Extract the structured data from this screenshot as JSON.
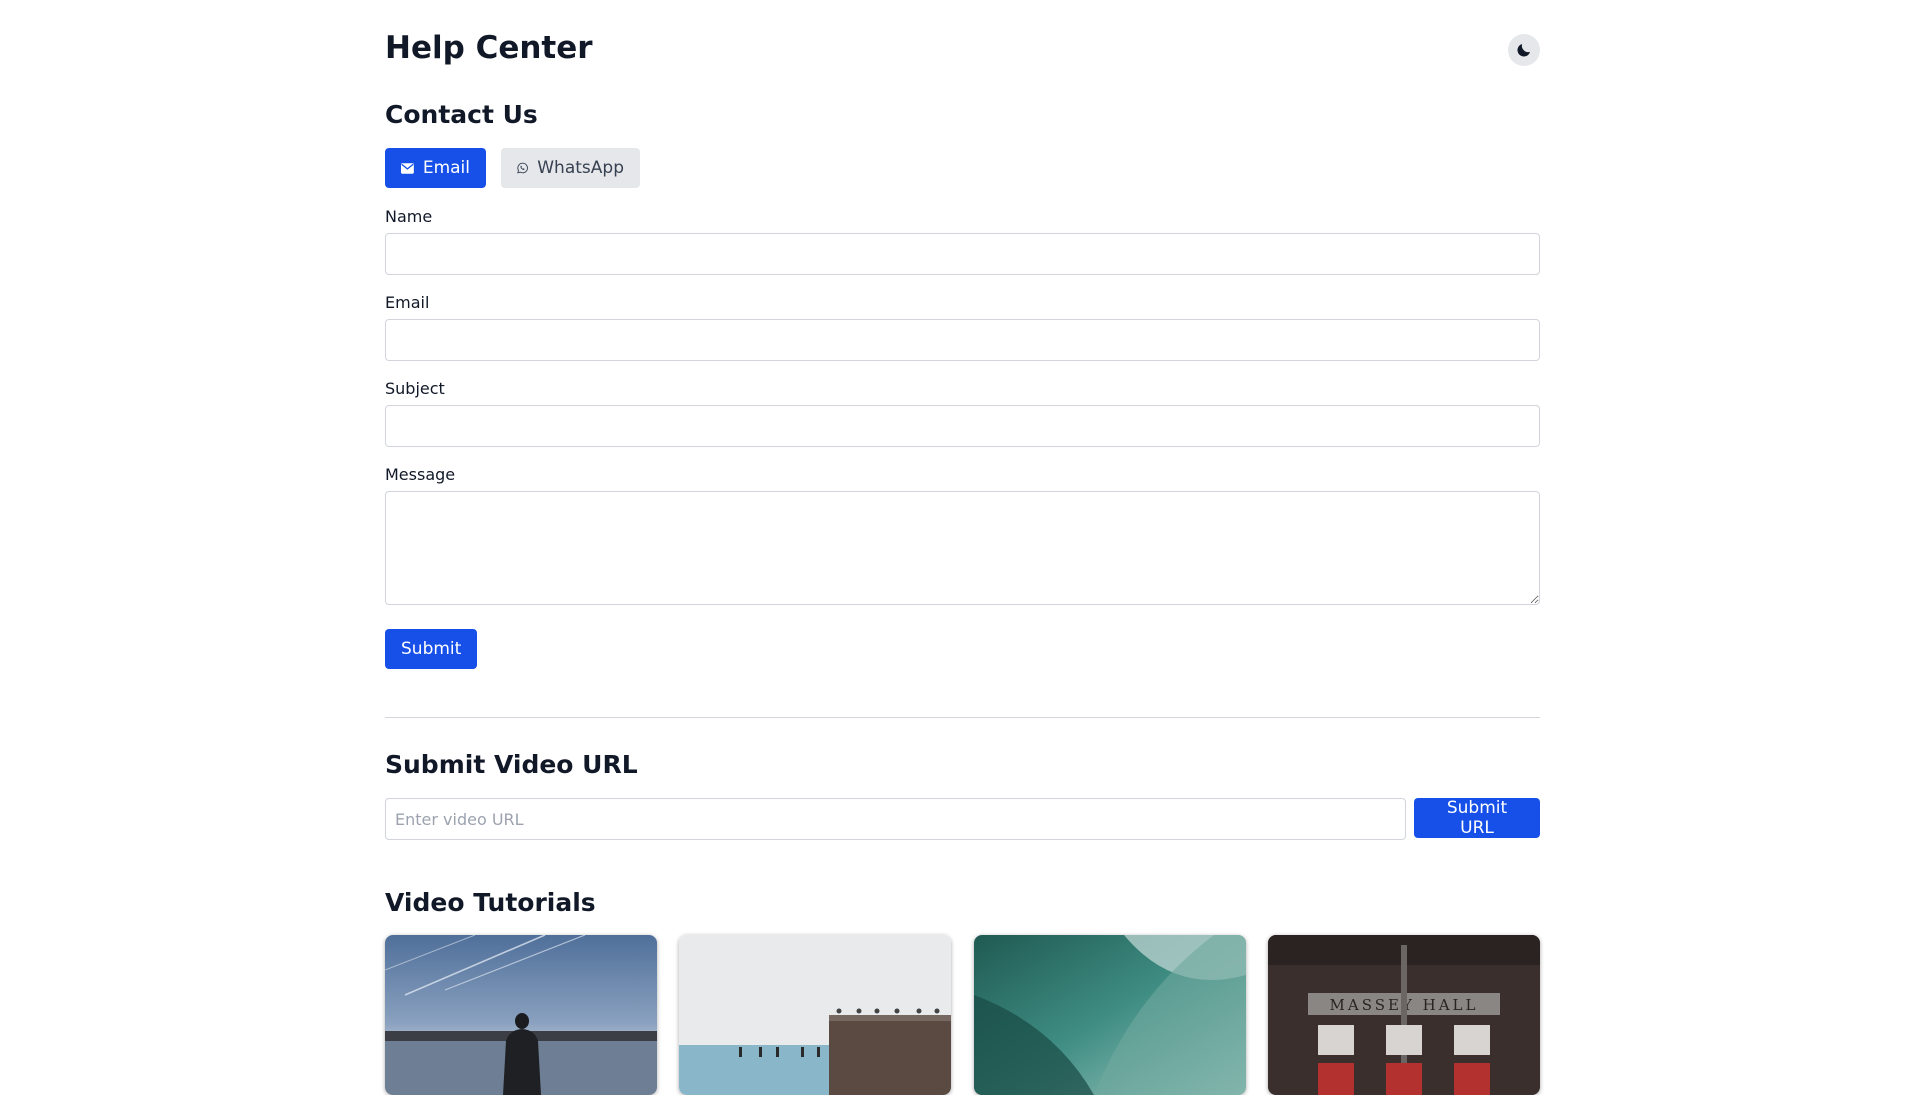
{
  "header": {
    "title": "Help Center",
    "theme_toggle_icon": "moon-icon"
  },
  "contact": {
    "title": "Contact Us",
    "tabs": [
      {
        "label": "Email",
        "icon": "envelope-icon",
        "active": true
      },
      {
        "label": "WhatsApp",
        "icon": "whatsapp-icon",
        "active": false
      }
    ],
    "fields": {
      "name_label": "Name",
      "name_value": "",
      "email_label": "Email",
      "email_value": "",
      "subject_label": "Subject",
      "subject_value": "",
      "message_label": "Message",
      "message_value": ""
    },
    "submit_label": "Submit"
  },
  "video_url": {
    "title": "Submit Video URL",
    "placeholder": "Enter video URL",
    "value": "",
    "submit_label": "Submit URL"
  },
  "tutorials": {
    "title": "Video Tutorials",
    "videos": [
      {
        "thumbnail": "man-by-lake-at-dusk"
      },
      {
        "thumbnail": "seabirds-on-pier-wall"
      },
      {
        "thumbnail": "ocean-wave-closeup"
      },
      {
        "thumbnail": "massey-hall-facade"
      }
    ],
    "sign_text": "MASSEY HALL"
  },
  "colors": {
    "primary": "#1650e8",
    "secondary_bg": "#e5e7eb",
    "text": "#111827",
    "border": "#d1d5db"
  }
}
